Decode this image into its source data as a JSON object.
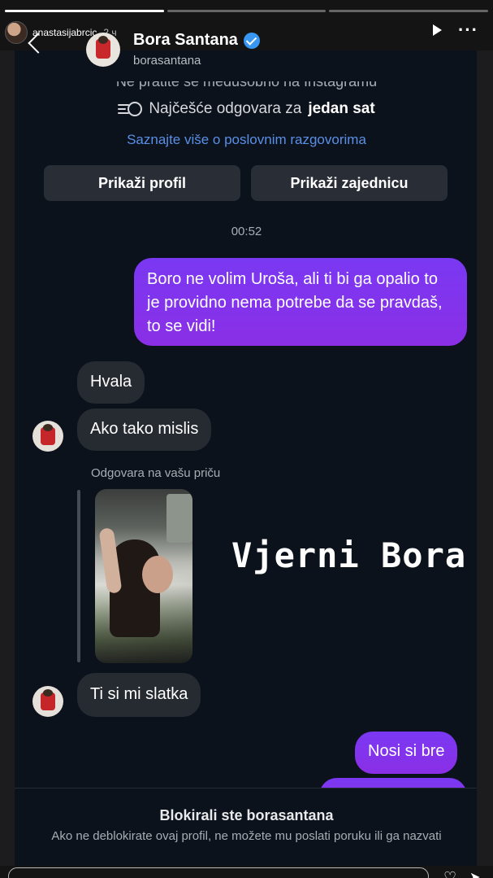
{
  "story": {
    "username": "anastasijabrcic",
    "time": "2 ч",
    "progress": [
      1,
      0,
      0
    ],
    "icons": [
      "play-icon",
      "more-icon",
      "heart-icon",
      "send-icon"
    ]
  },
  "chat": {
    "name": "Bora Santana",
    "handle": "borasantana",
    "verified": true,
    "info_line1": "Ne pratite se međusobno na Instagramu",
    "info_prefix": "Najčešće odgovara za",
    "info_bold": "jedan sat",
    "info_link": "Saznajte više o poslovnim razgovorima",
    "buttons": {
      "profile": "Prikaži profil",
      "community": "Prikaži zajednicu"
    },
    "timestamp": "00:52",
    "messages": {
      "out1": "Boro ne volim Uroša, ali ti bi ga opalio to je providno nema potrebe da se pravdaš, to se vidi!",
      "in1": "Hvala",
      "in2": "Ako tako mislis",
      "story_reply_label": "Odgovara na vašu priču",
      "in3": "Ti si mi slatka",
      "out2": "Nosi si bre",
      "out3": ""
    },
    "overlay_text": "Vjerni Bora",
    "footer": {
      "title": "Blokirali ste borasantana",
      "subtitle": "Ako ne deblokirate ovaj profil, ne možete mu poslati poruku ili ga nazvati"
    }
  },
  "colors": {
    "outgoing": "#7b32f0",
    "incoming": "#262a31",
    "background": "#0c121c",
    "link": "#5a8fe6",
    "verified": "#3897f0"
  }
}
